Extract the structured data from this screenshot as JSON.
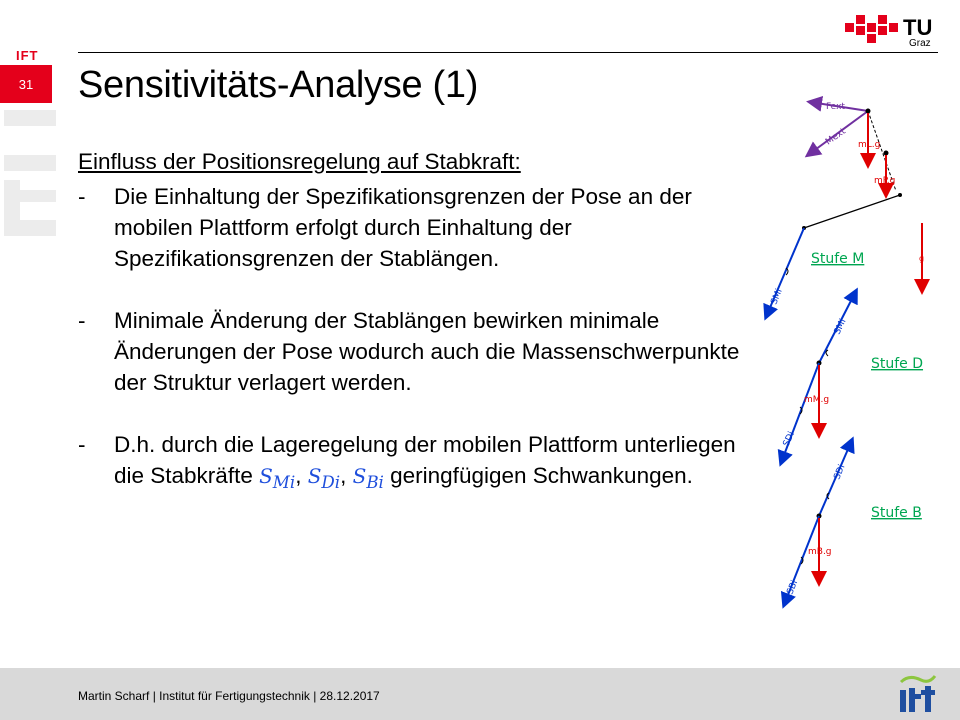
{
  "slide": {
    "number": "31",
    "ift_tab": "IFT"
  },
  "title": "Sensitivitäts-Analyse (1)",
  "subheading": "Einfluss der Positionsregelung auf Stabkraft:",
  "bullets": [
    {
      "dash": "-",
      "text": "Die Einhaltung der Spezifikationsgrenzen der Pose an der mobilen Plattform erfolgt durch Einhaltung der Spezifikationsgrenzen der Stablängen."
    },
    {
      "dash": "-",
      "text": "Minimale Änderung der Stablängen bewirken minimale Änderungen der Pose wodurch auch die Massenschwerpunkte der Struktur verlagert werden."
    },
    {
      "dash": "-",
      "text_before": "D.h. durch die Lageregelung der mobilen Plattform unterliegen die Stabkräfte ",
      "math": "S",
      "math_sub1": "Mi",
      "math_sub2": "Di",
      "math_sub3": "Bi",
      "text_after": " geringfügigen Schwankungen."
    }
  ],
  "diagram": {
    "labels": {
      "fext": "Fext",
      "mext": "Mext",
      "mlg": "mL.g",
      "mpg": "mP.g",
      "g": "g",
      "smi_upper": "SMi",
      "smi_lower": "SMi",
      "mmg": "mM.g",
      "sdi_upper": "SDi",
      "sdi_lower": "SDi",
      "mbg": "mB.g",
      "sbi": "SBi"
    },
    "stages": [
      "Stufe M",
      "Stufe D",
      "Stufe B"
    ],
    "colors": {
      "purple": "#7030a0",
      "red": "#e00000",
      "blue": "#0033cc",
      "green": "#00a651"
    }
  },
  "logo": {
    "tu_text": "TU",
    "graz_text": "Graz"
  },
  "footer": {
    "text": "Martin Scharf | Institut für Fertigungstechnik | 28.12.2017"
  },
  "colors": {
    "brand_red": "#e4001b",
    "footer_bg": "#d9d9d9"
  }
}
